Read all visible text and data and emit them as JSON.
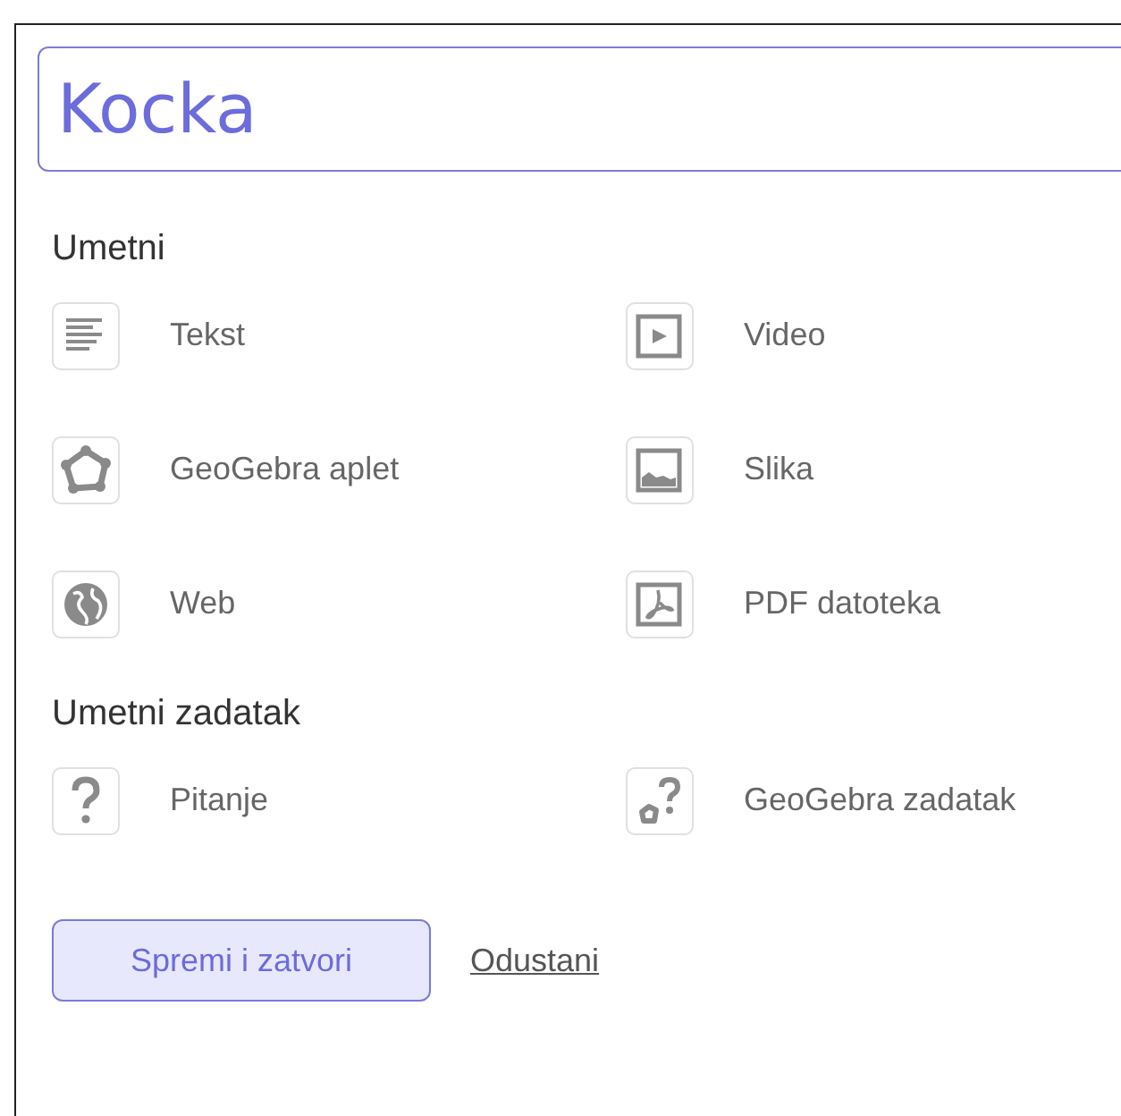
{
  "title_field": {
    "value": "Kocka"
  },
  "sections": [
    {
      "heading": "Umetni",
      "items": [
        {
          "kind": "text",
          "label": "Tekst"
        },
        {
          "kind": "video",
          "label": "Video"
        },
        {
          "kind": "applet",
          "label": "GeoGebra aplet"
        },
        {
          "kind": "image",
          "label": "Slika"
        },
        {
          "kind": "web",
          "label": "Web"
        },
        {
          "kind": "pdf",
          "label": "PDF datoteka"
        }
      ]
    },
    {
      "heading": "Umetni zadatak",
      "items": [
        {
          "kind": "question",
          "label": "Pitanje"
        },
        {
          "kind": "task",
          "label": "GeoGebra zadatak"
        }
      ]
    }
  ],
  "buttons": [
    {
      "kind": "primary",
      "label": "Spremi i zatvori"
    },
    {
      "kind": "link",
      "label": "Odustani"
    }
  ]
}
